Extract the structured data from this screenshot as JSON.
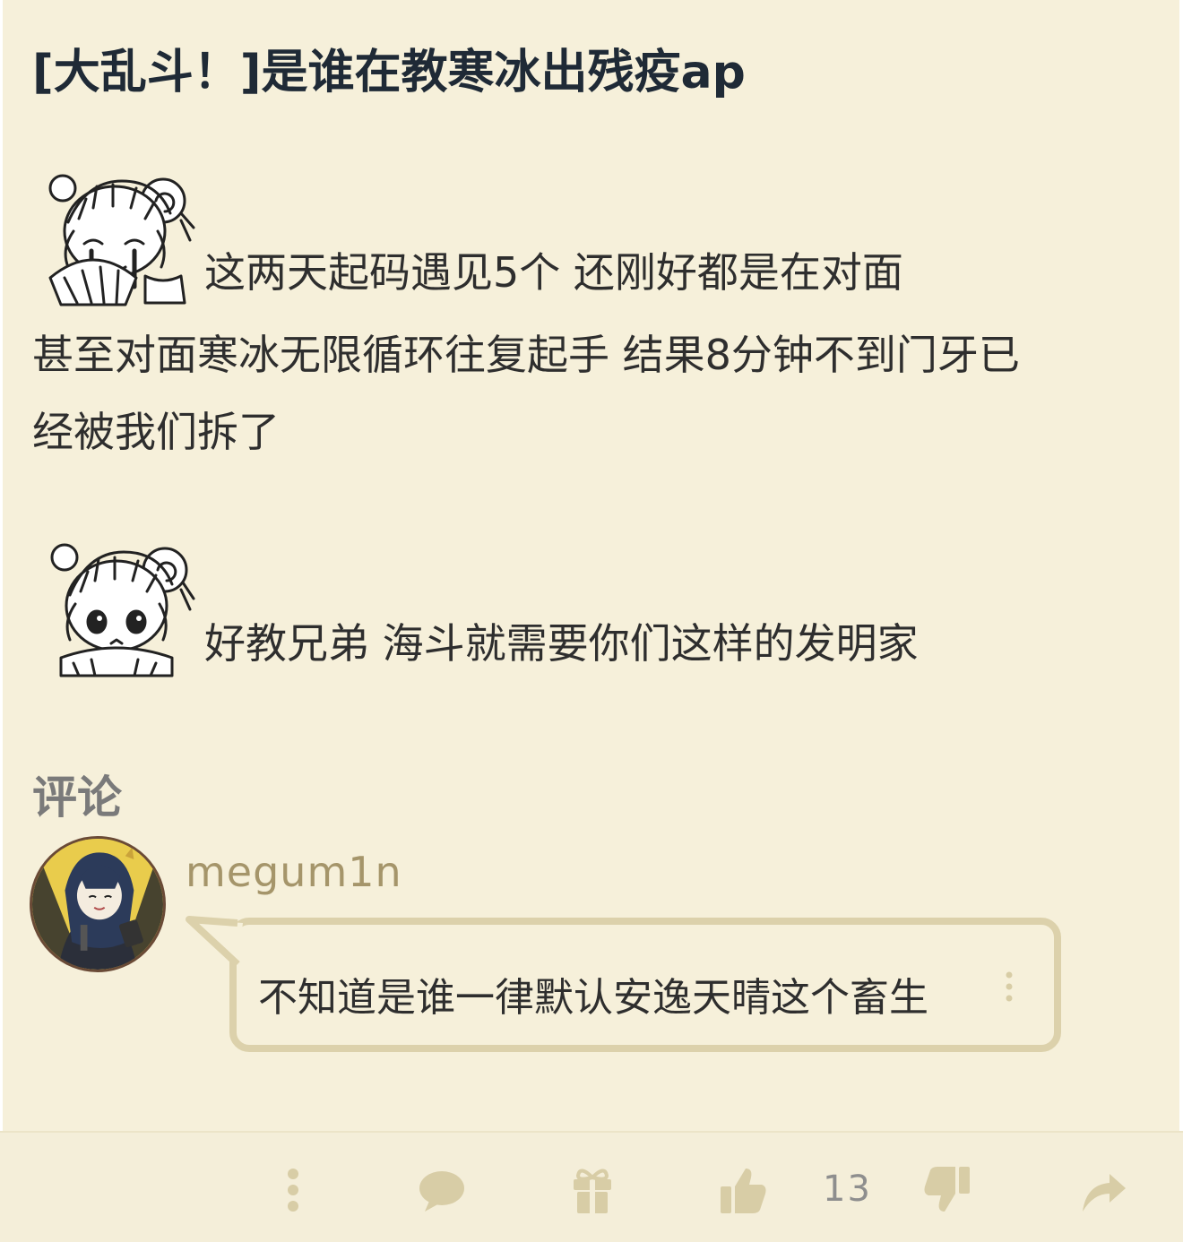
{
  "post": {
    "title": "[大乱斗！]是谁在教寒冰出残疫ap",
    "paragraph1_line1": "这两天起码遇见5个 还刚好都是在对面",
    "paragraph1_line2": "甚至对面寒冰无限循环往复起手 结果8分钟不到门牙已",
    "paragraph1_line3": "经被我们拆了",
    "paragraph2": "好教兄弟 海斗就需要你们这样的发明家",
    "stickers": [
      "crying-girl-sticker-icon",
      "smug-girl-sticker-icon"
    ]
  },
  "comments_section": {
    "heading": "评论",
    "items": [
      {
        "username": "megum1n",
        "text": "不知道是谁一律默认安逸天晴这个畜生"
      }
    ]
  },
  "bottom_bar": {
    "like_count": "13",
    "icons": [
      "more-vertical-icon",
      "comment-icon",
      "gift-icon",
      "thumbs-up-icon",
      "thumbs-down-icon",
      "share-icon"
    ]
  },
  "colors": {
    "background": "#f6f0da",
    "title": "#1f2a36",
    "username": "#a5956a",
    "bubble_border": "#dcd1ab",
    "toolbar_icon": "#d8cda6"
  }
}
